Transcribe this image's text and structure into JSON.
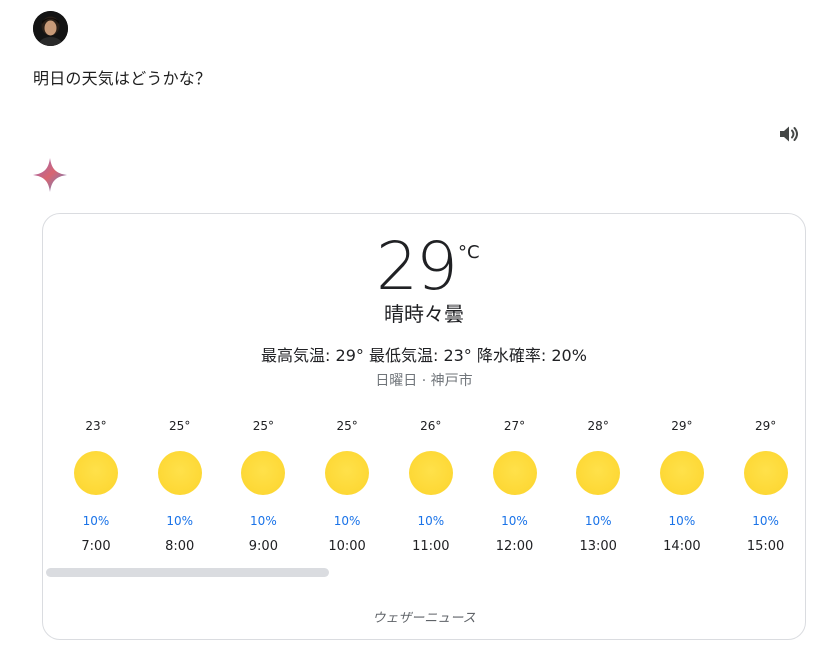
{
  "user": {
    "avatar_icon": "user-avatar"
  },
  "prompt": {
    "text": "明日の天気はどうかな？"
  },
  "toolbar": {
    "speaker_icon": "speaker-icon"
  },
  "assistant": {
    "icon": "gemini-sparkle-icon"
  },
  "weather": {
    "temperature": "29",
    "unit": "°C",
    "condition": "晴時々曇",
    "stats": "最高気温: 29° 最低気温: 23° 降水確率: 20%",
    "place": "日曜日 · 神戸市",
    "source": "ウェザーニュース",
    "colors": {
      "sun": "#fdd835",
      "precip": "#1a73e8"
    },
    "hourly": [
      {
        "temp": "23°",
        "precip": "10%",
        "time": "7:00",
        "icon": "sun-icon"
      },
      {
        "temp": "25°",
        "precip": "10%",
        "time": "8:00",
        "icon": "sun-icon"
      },
      {
        "temp": "25°",
        "precip": "10%",
        "time": "9:00",
        "icon": "sun-icon"
      },
      {
        "temp": "25°",
        "precip": "10%",
        "time": "10:00",
        "icon": "sun-icon"
      },
      {
        "temp": "26°",
        "precip": "10%",
        "time": "11:00",
        "icon": "sun-icon"
      },
      {
        "temp": "27°",
        "precip": "10%",
        "time": "12:00",
        "icon": "sun-icon"
      },
      {
        "temp": "28°",
        "precip": "10%",
        "time": "13:00",
        "icon": "sun-icon"
      },
      {
        "temp": "29°",
        "precip": "10%",
        "time": "14:00",
        "icon": "sun-icon"
      },
      {
        "temp": "29°",
        "precip": "10%",
        "time": "15:00",
        "icon": "sun-icon"
      }
    ]
  }
}
